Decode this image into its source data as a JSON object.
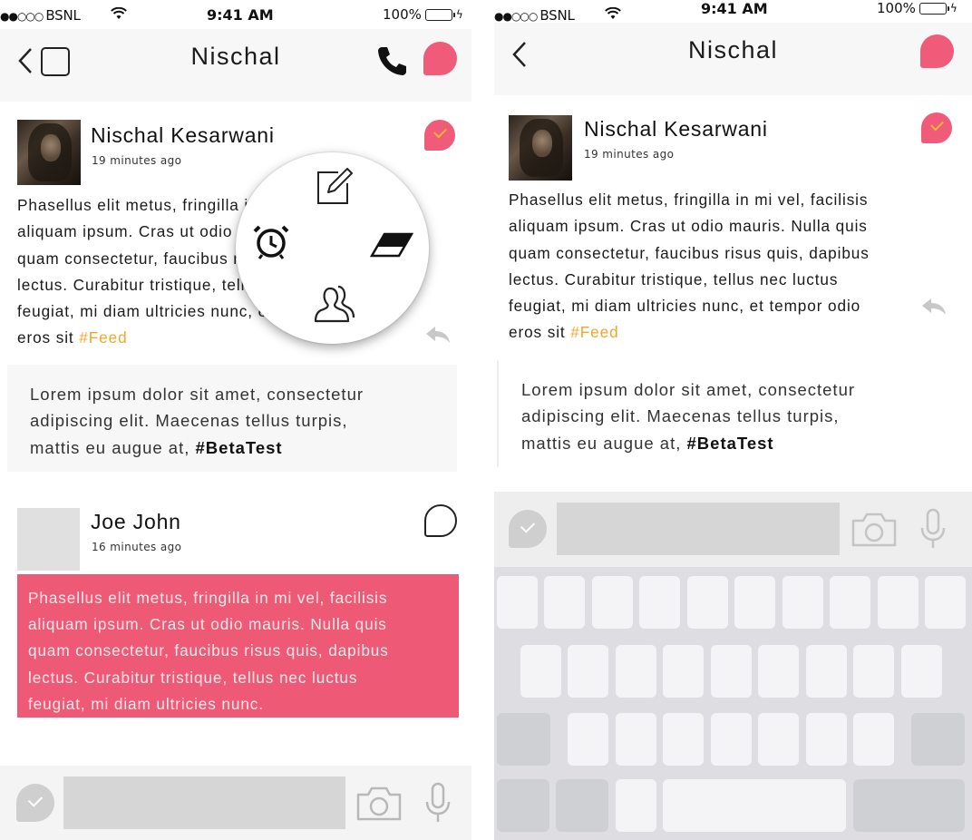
{
  "status_bar": {
    "carrier": "BSNL",
    "signal_dots": "●●○○○",
    "time": "9:41 AM",
    "battery": "100%"
  },
  "nav": {
    "title": "Nischal"
  },
  "post": {
    "author": "Nischal Kesarwani",
    "time_ago": "19 minutes ago",
    "text_lines": [
      "Phasellus elit metus, fringilla in mi vel, facilisis",
      "aliquam ipsum. Cras ut odio mauris. Nulla quis",
      "quam consectetur, faucibus risus quis, dapibus",
      "lectus. Curabitur tristique, tellus nec luctus",
      "feugiat, mi diam ultricies nunc, et tempor odio",
      "eros sit"
    ],
    "hashtag": "#Feed"
  },
  "quote": {
    "lines": [
      "Lorem ipsum dolor sit amet, consectetur",
      "adipiscing elit. Maecenas tellus turpis,",
      "mattis eu augue at,"
    ],
    "hashtag": "#BetaTest"
  },
  "second_post": {
    "author": "Joe John",
    "time_ago": "16 minutes ago",
    "text_lines": [
      "Phasellus elit metus, fringilla in mi vel, facilisis",
      "aliquam ipsum.  Cras ut odio mauris. Nulla quis",
      "quam consectetur, faucibus risus quis, dapibus",
      "lectus. Curabitur tristique, tellus nec luctus",
      "feugiat, mi diam ultricies nunc."
    ]
  },
  "radial_menu": {
    "options": [
      "edit-icon",
      "alarm-icon",
      "eraser-icon",
      "contacts-icon"
    ]
  },
  "icons": {
    "back": "chevron-left-icon",
    "square": "square-icon",
    "call": "phone-icon",
    "chat": "chat-bubble-icon",
    "check": "check-badge-icon",
    "reply": "reply-icon",
    "camera": "camera-icon",
    "mic": "mic-icon"
  },
  "colors": {
    "accent": "#ef5b78",
    "hashtag": "#f4a62a",
    "check": "#f7b733",
    "nav_bg": "#f7f7f7",
    "input_bg": "#d6d6d6",
    "keyboard_bg": "#dedee2"
  }
}
